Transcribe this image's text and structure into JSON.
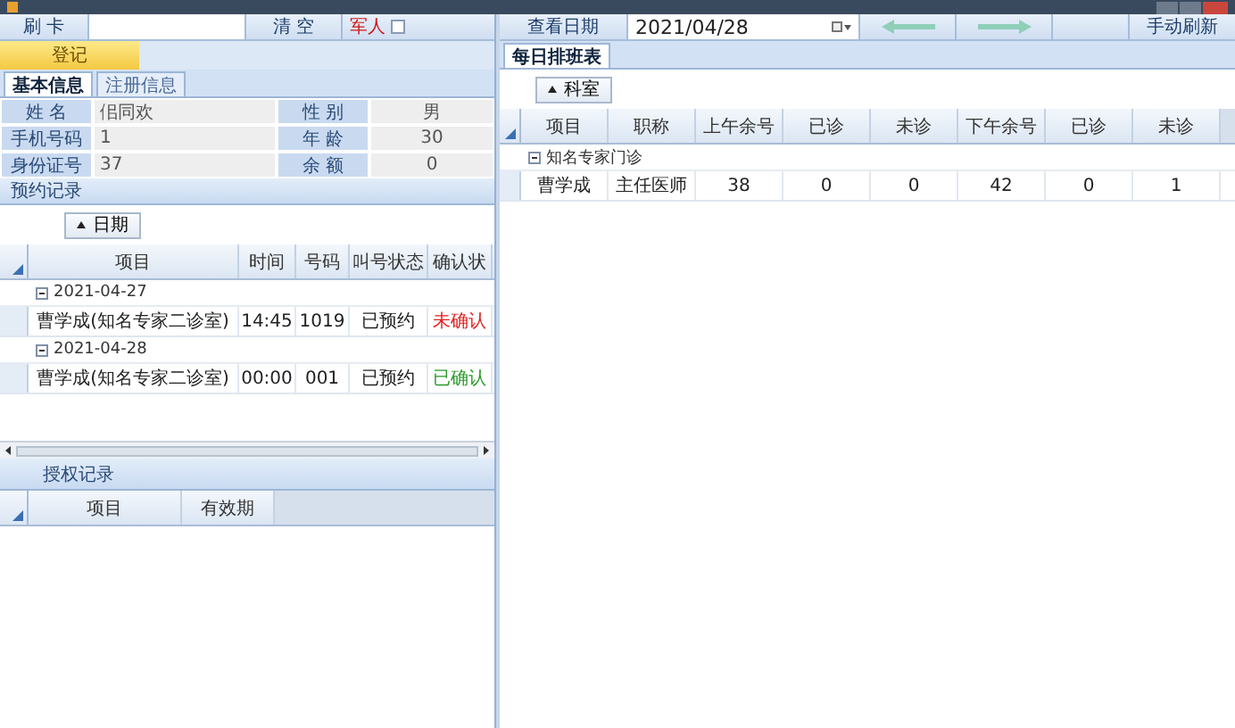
{
  "toolbar": {
    "card_label": "刷 卡",
    "clear_button": "清 空",
    "military": {
      "label": "军人",
      "checked": false
    }
  },
  "register_button": "登记",
  "info_tabs": [
    {
      "label": "基本信息",
      "selected": true
    },
    {
      "label": "注册信息",
      "selected": false
    }
  ],
  "info_rows": [
    [
      {
        "label": "姓 名",
        "value": "佀同欢"
      },
      {
        "label": "性 别",
        "value": "男"
      }
    ],
    [
      {
        "label": "手机号码",
        "value": "1"
      },
      {
        "label": "年 龄",
        "value": "30"
      }
    ],
    [
      {
        "label": "身份证号",
        "value": "37"
      },
      {
        "label": "余 额",
        "value": "0"
      }
    ]
  ],
  "appointments": {
    "title": "预约记录",
    "group_by": "日期",
    "columns": [
      "项目",
      "时间",
      "号码",
      "叫号状态",
      "确认状"
    ],
    "groups": [
      {
        "date": "2021-04-27",
        "expanded": true,
        "rows": [
          {
            "cells": [
              "曹学成(知名专家二诊室)",
              "14:45",
              "1019",
              "已预约"
            ],
            "status": "未确认",
            "confirmed": false
          }
        ]
      },
      {
        "date": "2021-04-28",
        "expanded": true,
        "rows": [
          {
            "cells": [
              "曹学成(知名专家二诊室)",
              "00:00",
              "001",
              "已预约"
            ],
            "status": "已确认",
            "confirmed": true
          }
        ]
      }
    ]
  },
  "authorizations": {
    "title": "授权记录",
    "columns": [
      "项目",
      "有效期"
    ]
  },
  "schedule": {
    "date_label": "查看日期",
    "date": "2021/04/28",
    "refresh_button": "手动刷新",
    "tab": "每日排班表",
    "group_by": "科室",
    "columns": [
      "项目",
      "职称",
      "上午余号",
      "已诊",
      "未诊",
      "下午余号",
      "已诊",
      "未诊"
    ],
    "groups": [
      {
        "name": "知名专家门诊",
        "expanded": true,
        "rows": [
          {
            "cells": [
              "曹学成",
              "主任医师",
              "38",
              "0",
              "0",
              "42",
              "0",
              "1"
            ]
          }
        ]
      }
    ]
  }
}
